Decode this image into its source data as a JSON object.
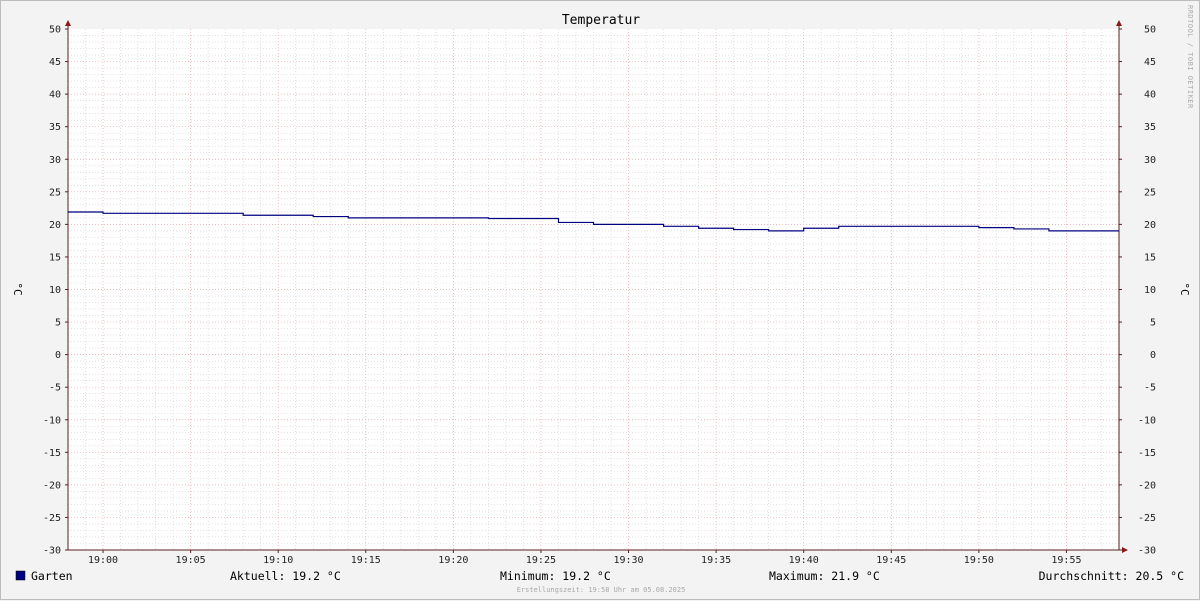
{
  "chart_data": {
    "type": "line",
    "title": "Temperatur",
    "ylabel_left": "°C",
    "ylabel_right": "°C",
    "ylim": [
      -30,
      50
    ],
    "y_ticks": [
      50,
      45,
      40,
      35,
      30,
      25,
      20,
      15,
      10,
      5,
      0,
      -5,
      -10,
      -15,
      -20,
      -25,
      -30
    ],
    "x_range_minutes": [
      "18:58",
      "19:58"
    ],
    "x_ticks": [
      "19:00",
      "19:05",
      "19:10",
      "19:15",
      "19:20",
      "19:25",
      "19:30",
      "19:35",
      "19:40",
      "19:45",
      "19:50",
      "19:55"
    ],
    "grid": true,
    "series": [
      {
        "name": "Garten",
        "color": "#000080",
        "step": true,
        "points": [
          [
            "18:58",
            21.9
          ],
          [
            "19:00",
            21.7
          ],
          [
            "19:08",
            21.4
          ],
          [
            "19:12",
            21.2
          ],
          [
            "19:14",
            21.0
          ],
          [
            "19:22",
            20.9
          ],
          [
            "19:26",
            20.3
          ],
          [
            "19:28",
            20.0
          ],
          [
            "19:32",
            19.7
          ],
          [
            "19:34",
            19.4
          ],
          [
            "19:36",
            19.2
          ],
          [
            "19:38",
            19.0
          ],
          [
            "19:40",
            19.4
          ],
          [
            "19:42",
            19.7
          ],
          [
            "19:50",
            19.5
          ],
          [
            "19:52",
            19.3
          ],
          [
            "19:54",
            19.0
          ],
          [
            "19:58",
            19.0
          ]
        ]
      }
    ]
  },
  "watermark": "RRDTOOL / TOBI OETIKER",
  "legend": {
    "series_name": "Garten",
    "series_color": "#000080",
    "current": "Aktuell: 19.2 °C",
    "minimum": "Minimum: 19.2 °C",
    "maximum": "Maximum: 21.9 °C",
    "average": "Durchschnitt: 20.5 °C"
  },
  "footer": "Erstellungszeit: 19:58 Uhr am 05.08.2025",
  "colors": {
    "major_grid": "#e8a8a8",
    "minor_grid": "#cfcfcf",
    "axis": "#5a2020",
    "axis_arrow": "#8b1a1a"
  }
}
